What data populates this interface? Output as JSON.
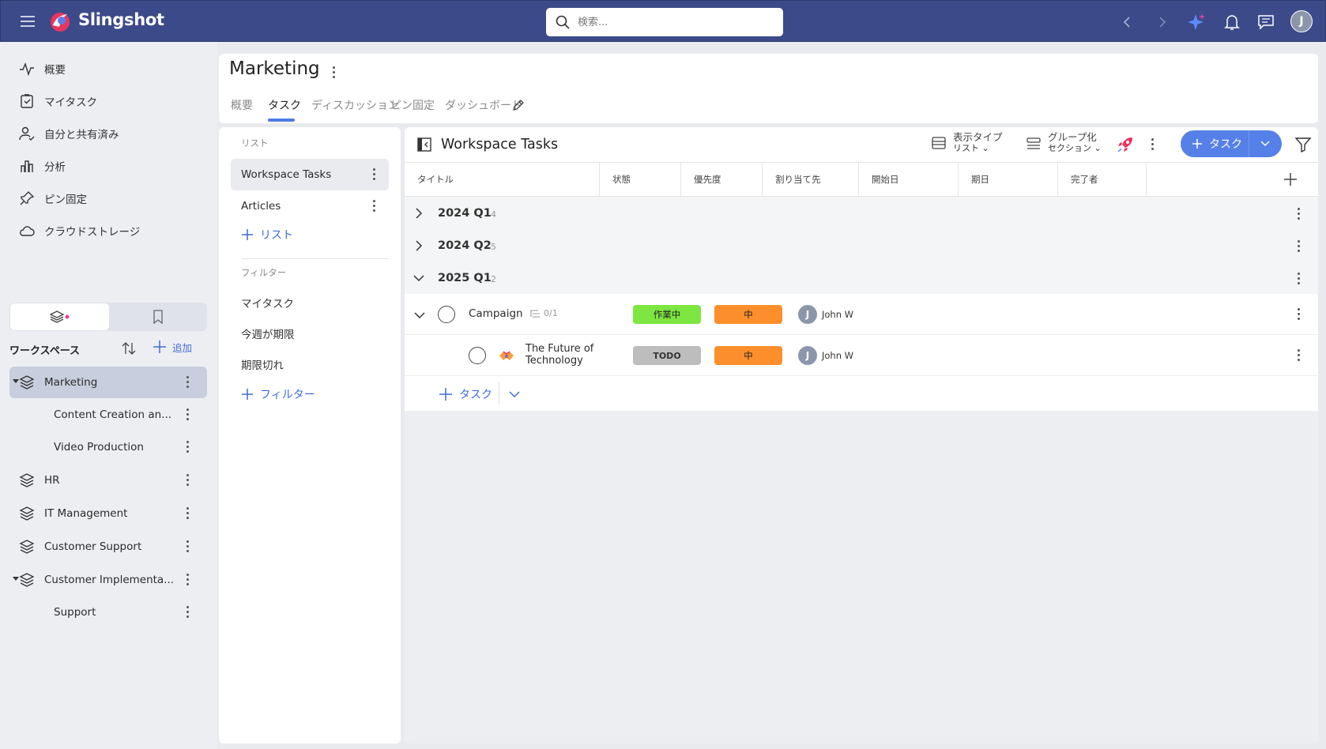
{
  "app": {
    "name": "Slingshot"
  },
  "search": {
    "placeholder": "検索..."
  },
  "user": {
    "initial": "J"
  },
  "nav": {
    "items": [
      "概要",
      "マイタスク",
      "自分と共有済み",
      "分析",
      "ピン固定",
      "クラウドストレージ"
    ]
  },
  "workspaces": {
    "title": "ワークスペース",
    "add_label": "追加",
    "items": [
      "Marketing",
      "Content Creation an...",
      "Video Production",
      "HR",
      "IT Management",
      "Customer Support",
      "Customer Implementa...",
      "Support"
    ]
  },
  "header": {
    "title": "Marketing",
    "tabs": [
      "概要",
      "タスク",
      "ディスカッション",
      "ピン固定",
      "ダッシュボード"
    ],
    "active_tab": "タスク"
  },
  "lists": {
    "section_label": "リスト",
    "items": [
      "Workspace Tasks",
      "Articles"
    ],
    "add_label": "リスト",
    "filter_label": "フィルター",
    "filters": [
      "マイタスク",
      "今週が期限",
      "期限切れ"
    ],
    "add_filter_label": "フィルター"
  },
  "tasks": {
    "title": "Workspace Tasks",
    "view_type_label": "表示タイプ",
    "view_type_value": "リスト",
    "group_label": "グループ化",
    "group_value": "セクション",
    "add_task_label": "タスク",
    "columns": [
      "タイトル",
      "状態",
      "優先度",
      "割り当て先",
      "開始日",
      "期日",
      "完了者"
    ],
    "groups": [
      {
        "name": "2024 Q1",
        "count": "4"
      },
      {
        "name": "2024 Q2",
        "count": "5"
      },
      {
        "name": "2025 Q1",
        "count": "2"
      }
    ],
    "rows": [
      {
        "title": "Campaign",
        "subtasks": "0/1",
        "status": "作業中",
        "status_color": "#7ee640",
        "priority": "中",
        "priority_color": "#fc8f2c",
        "assignee": "John W",
        "assignee_initial": "J"
      },
      {
        "title_line1": "The Future of",
        "title_line2": "Technology",
        "status": "TODO",
        "status_color": "#bdbdbd",
        "priority": "中",
        "priority_color": "#fc8f2c",
        "assignee": "John W",
        "assignee_initial": "J"
      }
    ],
    "add_row_label": "タスク"
  }
}
